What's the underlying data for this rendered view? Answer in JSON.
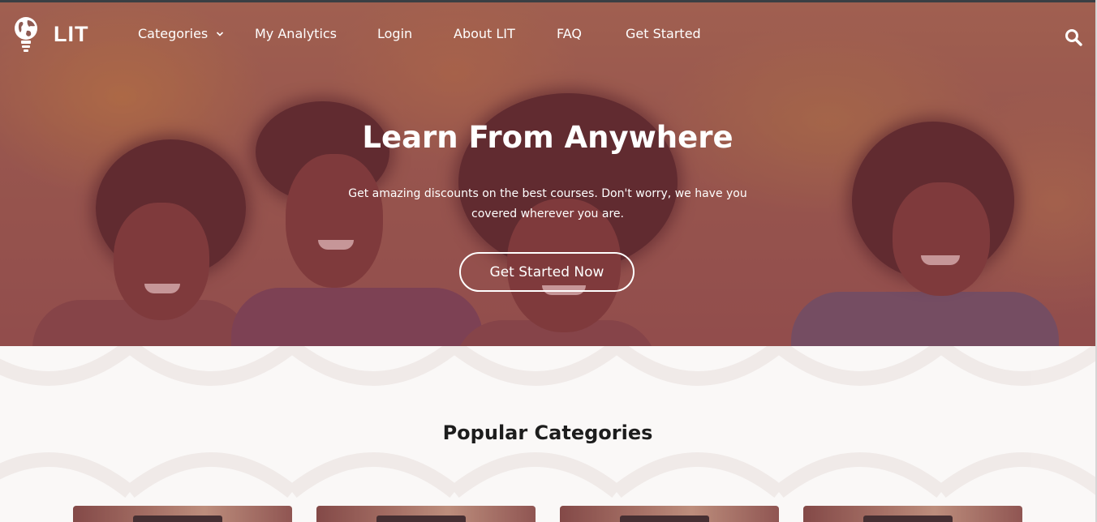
{
  "brand": {
    "name": "LIT"
  },
  "nav": {
    "items": [
      {
        "label": "Categories",
        "has_dropdown": true
      },
      {
        "label": "My Analytics"
      },
      {
        "label": "Login"
      },
      {
        "label": "About LIT"
      },
      {
        "label": "FAQ"
      },
      {
        "label": "Get Started"
      }
    ],
    "search_icon": "search-icon",
    "dropdown_icon": "chevron-down-icon"
  },
  "hero": {
    "title": "Learn From Anywhere",
    "subtitle": "Get amazing discounts on the best courses. Don't worry, we have you covered wherever you are.",
    "cta_label": "Get Started Now",
    "overlay_color": "#963c46"
  },
  "categories": {
    "title": "Popular Categories",
    "cards_visible": 4
  },
  "colors": {
    "nav_text": "#ffffff",
    "heading_text": "#1d1d1d",
    "section_background": "#faf8f7"
  }
}
